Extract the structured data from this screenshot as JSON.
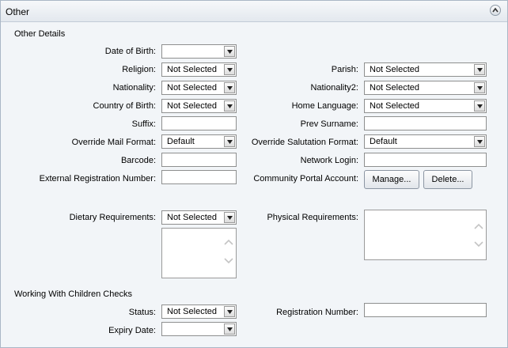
{
  "panel": {
    "title": "Other",
    "collapse_icon": "chevron-up-circle-icon"
  },
  "other_details": {
    "heading": "Other Details",
    "date_of_birth": {
      "label": "Date of Birth:",
      "value": ""
    },
    "religion": {
      "label": "Religion:",
      "value": "Not Selected"
    },
    "parish": {
      "label": "Parish:",
      "value": "Not Selected"
    },
    "nationality": {
      "label": "Nationality:",
      "value": "Not Selected"
    },
    "nationality2": {
      "label": "Nationality2:",
      "value": "Not Selected"
    },
    "country_of_birth": {
      "label": "Country of Birth:",
      "value": "Not Selected"
    },
    "home_language": {
      "label": "Home Language:",
      "value": "Not Selected"
    },
    "suffix": {
      "label": "Suffix:",
      "value": ""
    },
    "prev_surname": {
      "label": "Prev Surname:",
      "value": ""
    },
    "override_mail_format": {
      "label": "Override Mail Format:",
      "value": "Default"
    },
    "override_salutation_format": {
      "label": "Override Salutation Format:",
      "value": "Default"
    },
    "barcode": {
      "label": "Barcode:",
      "value": ""
    },
    "network_login": {
      "label": "Network Login:",
      "value": ""
    },
    "external_registration_number": {
      "label": "External Registration Number:",
      "value": ""
    },
    "community_portal_account": {
      "label": "Community Portal Account:",
      "manage_label": "Manage...",
      "delete_label": "Delete..."
    },
    "dietary_requirements": {
      "label": "Dietary Requirements:",
      "value": "Not Selected",
      "notes": ""
    },
    "physical_requirements": {
      "label": "Physical Requirements:",
      "notes": ""
    }
  },
  "wwcc": {
    "heading": "Working With Children Checks",
    "status": {
      "label": "Status:",
      "value": "Not Selected"
    },
    "registration_number": {
      "label": "Registration Number:",
      "value": ""
    },
    "expiry_date": {
      "label": "Expiry Date:",
      "value": ""
    }
  }
}
